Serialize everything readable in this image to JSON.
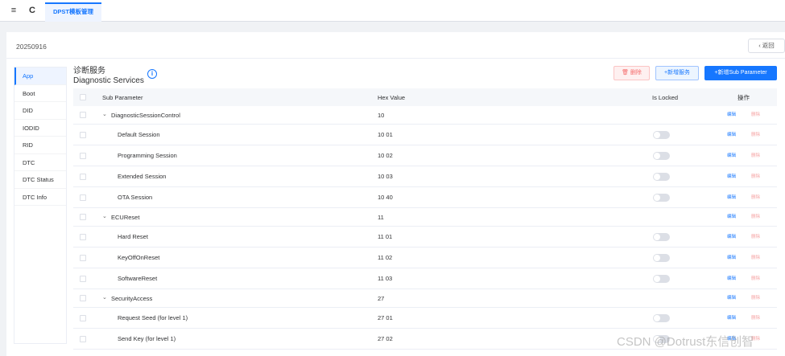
{
  "topbar": {
    "menu_icon": "≡",
    "refresh_icon": "C",
    "tab_label": "DPST模板管理"
  },
  "page": {
    "version": "20250916",
    "back_label": "返回"
  },
  "sidebar": {
    "items": [
      {
        "label": "App",
        "active": true
      },
      {
        "label": "Boot"
      },
      {
        "label": "DID"
      },
      {
        "label": "IODID"
      },
      {
        "label": "RID"
      },
      {
        "label": "DTC"
      },
      {
        "label": "DTC Status"
      },
      {
        "label": "DTC Info"
      }
    ]
  },
  "section": {
    "title_cn": "诊断服务",
    "title_en": "Diagnostic Services",
    "info_icon": "i",
    "delete_label": "删除",
    "add_service_label": "+新增服务",
    "add_sub_label": "+新增Sub Parameter"
  },
  "table": {
    "headers": {
      "sub_parameter": "Sub Parameter",
      "hex_value": "Hex Value",
      "is_locked": "Is Locked",
      "actions": "操作"
    },
    "edit_label": "编辑",
    "delete_label": "删除",
    "rows": [
      {
        "type": "parent",
        "name": "DiagnosticSessionControl",
        "hex": "10"
      },
      {
        "type": "child",
        "name": "Default Session",
        "hex": "10 01",
        "locked": false
      },
      {
        "type": "child",
        "name": "Programming Session",
        "hex": "10 02",
        "locked": false
      },
      {
        "type": "child",
        "name": "Extended Session",
        "hex": "10 03",
        "locked": false
      },
      {
        "type": "child",
        "name": "OTA Session",
        "hex": "10 40",
        "locked": false
      },
      {
        "type": "parent",
        "name": "ECUReset",
        "hex": "11"
      },
      {
        "type": "child",
        "name": "Hard Reset",
        "hex": "11 01",
        "locked": false
      },
      {
        "type": "child",
        "name": "KeyOffOnReset",
        "hex": "11 02",
        "locked": false
      },
      {
        "type": "child",
        "name": "SoftwareReset",
        "hex": "11 03",
        "locked": false
      },
      {
        "type": "parent",
        "name": "SecurityAccess",
        "hex": "27"
      },
      {
        "type": "child",
        "name": "Request Seed (for level 1)",
        "hex": "27 01",
        "locked": false
      },
      {
        "type": "child",
        "name": "Send Key (for level 1)",
        "hex": "27 02",
        "locked": false
      }
    ]
  },
  "watermark": "CSDN @Dotrust东信创智"
}
